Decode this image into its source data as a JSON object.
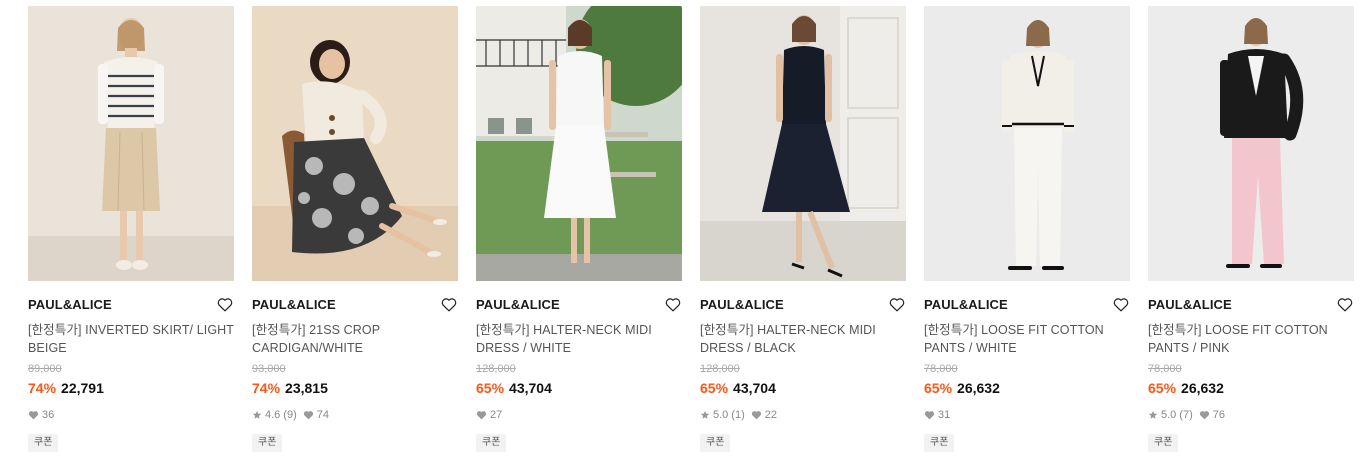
{
  "products": [
    {
      "brand": "PAUL&ALICE",
      "name": "[한정특가] INVERTED SKIRT/ LIGHT BEIGE",
      "original_price": "89,000",
      "discount": "74%",
      "price": "22,791",
      "rating": "",
      "review_count": "",
      "likes": "36",
      "coupon": "쿠폰",
      "image": "model-knit-vest-skirt"
    },
    {
      "brand": "PAUL&ALICE",
      "name": "[한정특가] 21SS CROP CARDIGAN/WHITE",
      "original_price": "93,000",
      "discount": "74%",
      "price": "23,815",
      "rating": "4.6",
      "review_count": "(9)",
      "likes": "74",
      "coupon": "쿠폰",
      "image": "model-cardigan-floral-skirt"
    },
    {
      "brand": "PAUL&ALICE",
      "name": "[한정특가] HALTER-NECK MIDI DRESS / WHITE",
      "original_price": "128,000",
      "discount": "65%",
      "price": "43,704",
      "rating": "",
      "review_count": "",
      "likes": "27",
      "coupon": "쿠폰",
      "image": "model-white-dress"
    },
    {
      "brand": "PAUL&ALICE",
      "name": "[한정특가] HALTER-NECK MIDI DRESS / BLACK",
      "original_price": "128,000",
      "discount": "65%",
      "price": "43,704",
      "rating": "5.0",
      "review_count": "(1)",
      "likes": "22",
      "coupon": "쿠폰",
      "image": "model-black-dress"
    },
    {
      "brand": "PAUL&ALICE",
      "name": "[한정특가] LOOSE FIT COTTON PANTS / WHITE",
      "original_price": "78,000",
      "discount": "65%",
      "price": "26,632",
      "rating": "",
      "review_count": "",
      "likes": "31",
      "coupon": "쿠폰",
      "image": "model-white-pants"
    },
    {
      "brand": "PAUL&ALICE",
      "name": "[한정특가] LOOSE FIT COTTON PANTS / PINK",
      "original_price": "78,000",
      "discount": "65%",
      "price": "26,632",
      "rating": "5.0",
      "review_count": "(7)",
      "likes": "76",
      "coupon": "쿠폰",
      "image": "model-pink-pants"
    }
  ],
  "icons": {
    "wishlist": "heart-outline-icon",
    "like": "heart-icon",
    "rating": "star-icon"
  },
  "colors": {
    "discount": "#ef5a1e",
    "price": "#111111",
    "original_price": "#aaaaaa",
    "meta": "#888888"
  }
}
